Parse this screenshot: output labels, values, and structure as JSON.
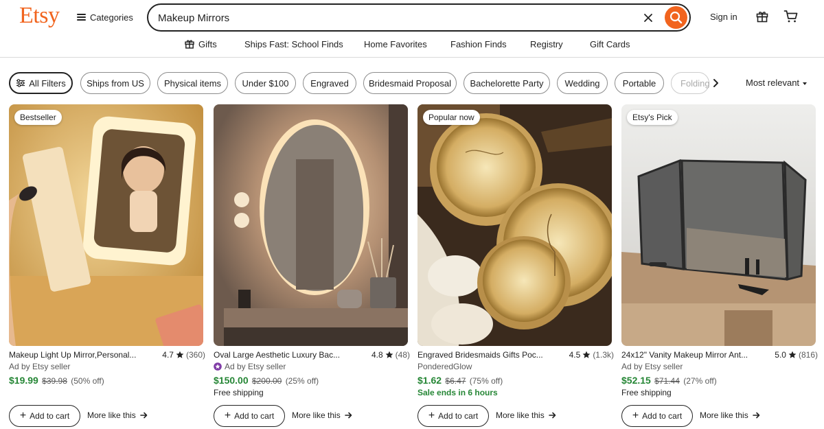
{
  "header": {
    "logo": "Etsy",
    "categories_label": "Categories",
    "search_value": "Makeup Mirrors",
    "sign_in": "Sign in"
  },
  "subnav": {
    "items": [
      "Gifts",
      "Ships Fast: School Finds",
      "Home Favorites",
      "Fashion Finds",
      "Registry",
      "Gift Cards"
    ]
  },
  "filters": {
    "all_filters": "All Filters",
    "pills": [
      "Ships from US",
      "Physical items",
      "Under $100",
      "Engraved",
      "Bridesmaid Proposal",
      "Bachelorette Party",
      "Wedding",
      "Portable",
      "Folding"
    ],
    "sort": "Most relevant"
  },
  "listings": [
    {
      "badge": "Bestseller",
      "title": "Makeup Light Up Mirror,Personal...",
      "rating": "4.7",
      "reviews": "(360)",
      "seller": "Ad by Etsy seller",
      "price": "$19.99",
      "original_price": "$39.98",
      "discount": "(50% off)",
      "extra": "",
      "add_to_cart": "Add to cart",
      "more_like_this": "More like this"
    },
    {
      "badge": "",
      "title": "Oval Large Aesthetic Luxury Bac...",
      "rating": "4.8",
      "reviews": "(48)",
      "seller": "Ad by Etsy seller",
      "price": "$150.00",
      "original_price": "$200.00",
      "discount": "(25% off)",
      "extra": "Free shipping",
      "add_to_cart": "Add to cart",
      "more_like_this": "More like this"
    },
    {
      "badge": "Popular now",
      "title": "Engraved Bridesmaids Gifts Poc...",
      "rating": "4.5",
      "reviews": "(1.3k)",
      "seller": "PonderedGlow",
      "price": "$1.62",
      "original_price": "$6.47",
      "discount": "(75% off)",
      "extra": "Sale ends in 6 hours",
      "add_to_cart": "Add to cart",
      "more_like_this": "More like this"
    },
    {
      "badge": "Etsy's Pick",
      "title": "24x12\" Vanity Makeup Mirror Ant...",
      "rating": "5.0",
      "reviews": "(816)",
      "seller": "Ad by Etsy seller",
      "price": "$52.15",
      "original_price": "$71.44",
      "discount": "(27% off)",
      "extra": "Free shipping",
      "add_to_cart": "Add to cart",
      "more_like_this": "More like this"
    }
  ],
  "colors": {
    "brand": "#f1641e",
    "price_green": "#258635",
    "text": "#222222"
  },
  "icons": [
    "hamburger-icon",
    "clear-icon",
    "search-icon",
    "gift-icon",
    "cart-icon",
    "filter-sliders-icon",
    "chevron-right-icon",
    "caret-down-icon",
    "star-icon",
    "star-seller-icon",
    "plus-icon",
    "arrow-right-icon"
  ]
}
